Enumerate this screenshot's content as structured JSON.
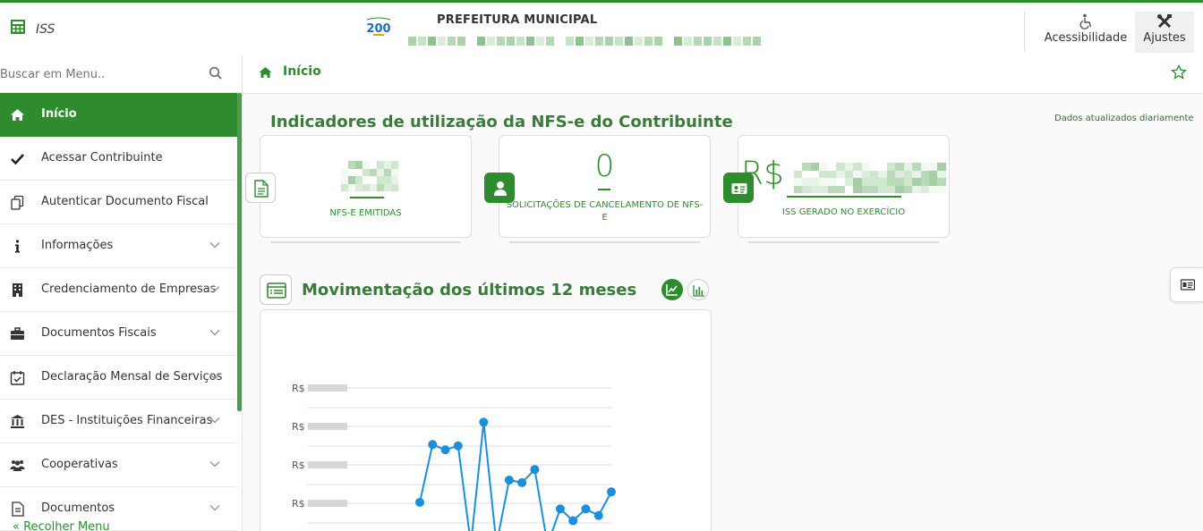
{
  "header": {
    "app_name": "ISS",
    "title": "PREFEITURA MUNICIPAL",
    "accessibility_label": "Acessibilidade",
    "settings_label": "Ajustes",
    "logo_text": "200"
  },
  "sidebar": {
    "search_placeholder": "Buscar em Menu..",
    "items": [
      {
        "label": "Início",
        "icon": "home-icon",
        "active": true
      },
      {
        "label": "Acessar Contribuinte",
        "icon": "check-icon"
      },
      {
        "label": "Autenticar Documento Fiscal",
        "icon": "documents-icon"
      },
      {
        "label": "Informações",
        "icon": "info-icon",
        "expandable": true
      },
      {
        "label": "Credenciamento de Empresas",
        "icon": "building-icon",
        "expandable": true
      },
      {
        "label": "Documentos Fiscais",
        "icon": "briefcase-icon",
        "expandable": true
      },
      {
        "label": "Declaração Mensal de Serviços",
        "icon": "calendar-check-icon",
        "expandable": true
      },
      {
        "label": "DES - Instituições Financeiras",
        "icon": "bank-icon",
        "expandable": true
      },
      {
        "label": "Cooperativas",
        "icon": "users-icon",
        "expandable": true
      },
      {
        "label": "Documentos",
        "icon": "file-text-icon",
        "expandable": true
      }
    ],
    "collapse_label": "«   Recolher Menu"
  },
  "breadcrumb": {
    "label": "Início"
  },
  "indicators": {
    "title": "Indicadores de utilização da NFS-e do Contribuinte",
    "updated_note": "Dados atualizados diariamente",
    "cards": [
      {
        "caption": "NFS-E EMITIDAS",
        "icon": "document-icon"
      },
      {
        "value": "0",
        "caption": "SOLICITAÇÕES DE CANCELAMENTO DE NFS-E",
        "icon": "user-icon"
      },
      {
        "prefix": "R$",
        "caption": "ISS GERADO NO EXERCÍCIO",
        "icon": "id-card-icon"
      }
    ]
  },
  "chart_section": {
    "title": "Movimentação dos últimos 12 meses",
    "line_toggle_icon": "line-chart-icon",
    "bar_toggle_icon": "bar-chart-icon"
  },
  "chart_data": {
    "type": "line",
    "y_tick_labels": [
      "R$",
      "R$",
      "R$",
      "R$"
    ],
    "series": [
      {
        "color": "#1a8fdc",
        "values": [
          0.32,
          0.76,
          0.72,
          0.75,
          0.0,
          0.93,
          0.0,
          0.49,
          0.47,
          0.57,
          0.0,
          0.27,
          0.18,
          0.27,
          0.22,
          0.4
        ]
      }
    ],
    "grid": true
  },
  "colors": {
    "brand": "#2e8b2e",
    "series": "#1a8fdc"
  }
}
